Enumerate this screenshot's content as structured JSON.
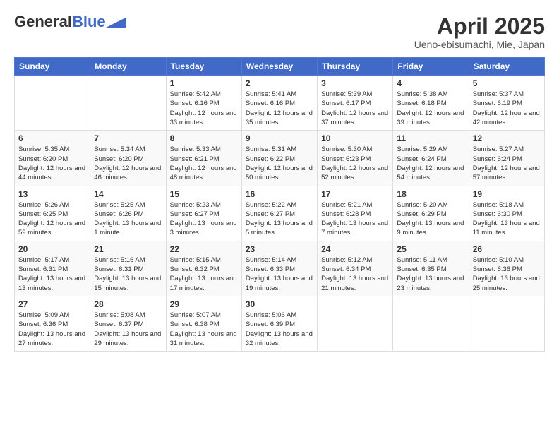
{
  "header": {
    "logo_general": "General",
    "logo_blue": "Blue",
    "title": "April 2025",
    "subtitle": "Ueno-ebisumachi, Mie, Japan"
  },
  "weekdays": [
    "Sunday",
    "Monday",
    "Tuesday",
    "Wednesday",
    "Thursday",
    "Friday",
    "Saturday"
  ],
  "weeks": [
    [
      {
        "day": "",
        "sunrise": "",
        "sunset": "",
        "daylight": ""
      },
      {
        "day": "",
        "sunrise": "",
        "sunset": "",
        "daylight": ""
      },
      {
        "day": "1",
        "sunrise": "Sunrise: 5:42 AM",
        "sunset": "Sunset: 6:16 PM",
        "daylight": "Daylight: 12 hours and 33 minutes."
      },
      {
        "day": "2",
        "sunrise": "Sunrise: 5:41 AM",
        "sunset": "Sunset: 6:16 PM",
        "daylight": "Daylight: 12 hours and 35 minutes."
      },
      {
        "day": "3",
        "sunrise": "Sunrise: 5:39 AM",
        "sunset": "Sunset: 6:17 PM",
        "daylight": "Daylight: 12 hours and 37 minutes."
      },
      {
        "day": "4",
        "sunrise": "Sunrise: 5:38 AM",
        "sunset": "Sunset: 6:18 PM",
        "daylight": "Daylight: 12 hours and 39 minutes."
      },
      {
        "day": "5",
        "sunrise": "Sunrise: 5:37 AM",
        "sunset": "Sunset: 6:19 PM",
        "daylight": "Daylight: 12 hours and 42 minutes."
      }
    ],
    [
      {
        "day": "6",
        "sunrise": "Sunrise: 5:35 AM",
        "sunset": "Sunset: 6:20 PM",
        "daylight": "Daylight: 12 hours and 44 minutes."
      },
      {
        "day": "7",
        "sunrise": "Sunrise: 5:34 AM",
        "sunset": "Sunset: 6:20 PM",
        "daylight": "Daylight: 12 hours and 46 minutes."
      },
      {
        "day": "8",
        "sunrise": "Sunrise: 5:33 AM",
        "sunset": "Sunset: 6:21 PM",
        "daylight": "Daylight: 12 hours and 48 minutes."
      },
      {
        "day": "9",
        "sunrise": "Sunrise: 5:31 AM",
        "sunset": "Sunset: 6:22 PM",
        "daylight": "Daylight: 12 hours and 50 minutes."
      },
      {
        "day": "10",
        "sunrise": "Sunrise: 5:30 AM",
        "sunset": "Sunset: 6:23 PM",
        "daylight": "Daylight: 12 hours and 52 minutes."
      },
      {
        "day": "11",
        "sunrise": "Sunrise: 5:29 AM",
        "sunset": "Sunset: 6:24 PM",
        "daylight": "Daylight: 12 hours and 54 minutes."
      },
      {
        "day": "12",
        "sunrise": "Sunrise: 5:27 AM",
        "sunset": "Sunset: 6:24 PM",
        "daylight": "Daylight: 12 hours and 57 minutes."
      }
    ],
    [
      {
        "day": "13",
        "sunrise": "Sunrise: 5:26 AM",
        "sunset": "Sunset: 6:25 PM",
        "daylight": "Daylight: 12 hours and 59 minutes."
      },
      {
        "day": "14",
        "sunrise": "Sunrise: 5:25 AM",
        "sunset": "Sunset: 6:26 PM",
        "daylight": "Daylight: 13 hours and 1 minute."
      },
      {
        "day": "15",
        "sunrise": "Sunrise: 5:23 AM",
        "sunset": "Sunset: 6:27 PM",
        "daylight": "Daylight: 13 hours and 3 minutes."
      },
      {
        "day": "16",
        "sunrise": "Sunrise: 5:22 AM",
        "sunset": "Sunset: 6:27 PM",
        "daylight": "Daylight: 13 hours and 5 minutes."
      },
      {
        "day": "17",
        "sunrise": "Sunrise: 5:21 AM",
        "sunset": "Sunset: 6:28 PM",
        "daylight": "Daylight: 13 hours and 7 minutes."
      },
      {
        "day": "18",
        "sunrise": "Sunrise: 5:20 AM",
        "sunset": "Sunset: 6:29 PM",
        "daylight": "Daylight: 13 hours and 9 minutes."
      },
      {
        "day": "19",
        "sunrise": "Sunrise: 5:18 AM",
        "sunset": "Sunset: 6:30 PM",
        "daylight": "Daylight: 13 hours and 11 minutes."
      }
    ],
    [
      {
        "day": "20",
        "sunrise": "Sunrise: 5:17 AM",
        "sunset": "Sunset: 6:31 PM",
        "daylight": "Daylight: 13 hours and 13 minutes."
      },
      {
        "day": "21",
        "sunrise": "Sunrise: 5:16 AM",
        "sunset": "Sunset: 6:31 PM",
        "daylight": "Daylight: 13 hours and 15 minutes."
      },
      {
        "day": "22",
        "sunrise": "Sunrise: 5:15 AM",
        "sunset": "Sunset: 6:32 PM",
        "daylight": "Daylight: 13 hours and 17 minutes."
      },
      {
        "day": "23",
        "sunrise": "Sunrise: 5:14 AM",
        "sunset": "Sunset: 6:33 PM",
        "daylight": "Daylight: 13 hours and 19 minutes."
      },
      {
        "day": "24",
        "sunrise": "Sunrise: 5:12 AM",
        "sunset": "Sunset: 6:34 PM",
        "daylight": "Daylight: 13 hours and 21 minutes."
      },
      {
        "day": "25",
        "sunrise": "Sunrise: 5:11 AM",
        "sunset": "Sunset: 6:35 PM",
        "daylight": "Daylight: 13 hours and 23 minutes."
      },
      {
        "day": "26",
        "sunrise": "Sunrise: 5:10 AM",
        "sunset": "Sunset: 6:36 PM",
        "daylight": "Daylight: 13 hours and 25 minutes."
      }
    ],
    [
      {
        "day": "27",
        "sunrise": "Sunrise: 5:09 AM",
        "sunset": "Sunset: 6:36 PM",
        "daylight": "Daylight: 13 hours and 27 minutes."
      },
      {
        "day": "28",
        "sunrise": "Sunrise: 5:08 AM",
        "sunset": "Sunset: 6:37 PM",
        "daylight": "Daylight: 13 hours and 29 minutes."
      },
      {
        "day": "29",
        "sunrise": "Sunrise: 5:07 AM",
        "sunset": "Sunset: 6:38 PM",
        "daylight": "Daylight: 13 hours and 31 minutes."
      },
      {
        "day": "30",
        "sunrise": "Sunrise: 5:06 AM",
        "sunset": "Sunset: 6:39 PM",
        "daylight": "Daylight: 13 hours and 32 minutes."
      },
      {
        "day": "",
        "sunrise": "",
        "sunset": "",
        "daylight": ""
      },
      {
        "day": "",
        "sunrise": "",
        "sunset": "",
        "daylight": ""
      },
      {
        "day": "",
        "sunrise": "",
        "sunset": "",
        "daylight": ""
      }
    ]
  ]
}
